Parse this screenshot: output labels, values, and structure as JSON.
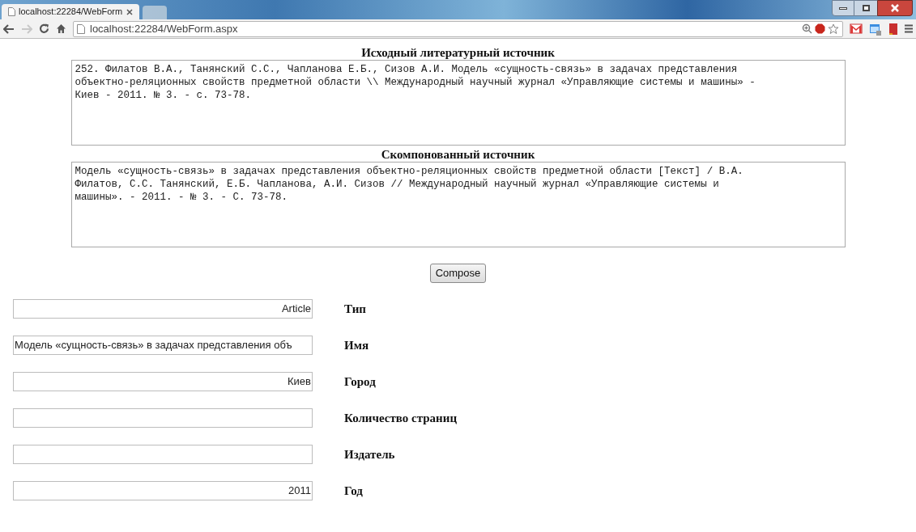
{
  "browser": {
    "tab": {
      "title": "localhost:22284/WebForm",
      "selected": true
    },
    "address": "localhost:22284/WebForm.aspx",
    "forward_disabled": true
  },
  "source": {
    "title": "Исходный литературный источник",
    "text": "252. Филатов В.А., Танянский С.С., Чапланова Е.Б., Сизов А.И. Модель «сущность-связь» в задачах представления\nобъектно-реляционных свойств предметной области \\\\ Международный научный журнал «Управляющие системы и машины» -\nКиев - 2011. № 3. - с. 73-78."
  },
  "composed": {
    "title": "Скомпонованный источник",
    "text": "Модель «сущность-связь» в задачах представления объектно-реляционных свойств предметной области [Текст] / В.А.\nФилатов, С.С. Танянский, Е.Б. Чапланова, А.И. Сизов // Международный научный журнал «Управляющие системы и\nмашины». - 2011. - № 3. - С. 73-78."
  },
  "compose_button": "Compose",
  "fields": [
    {
      "label": "Тип",
      "value": "Article"
    },
    {
      "label": "Имя",
      "value": "Модель «сущность-связь» в задачах представления объ"
    },
    {
      "label": "Город",
      "value": "Киев"
    },
    {
      "label": "Количество страниц"
    },
    {
      "label": "Издатель"
    },
    {
      "label": "Год",
      "value": "2011"
    }
  ]
}
